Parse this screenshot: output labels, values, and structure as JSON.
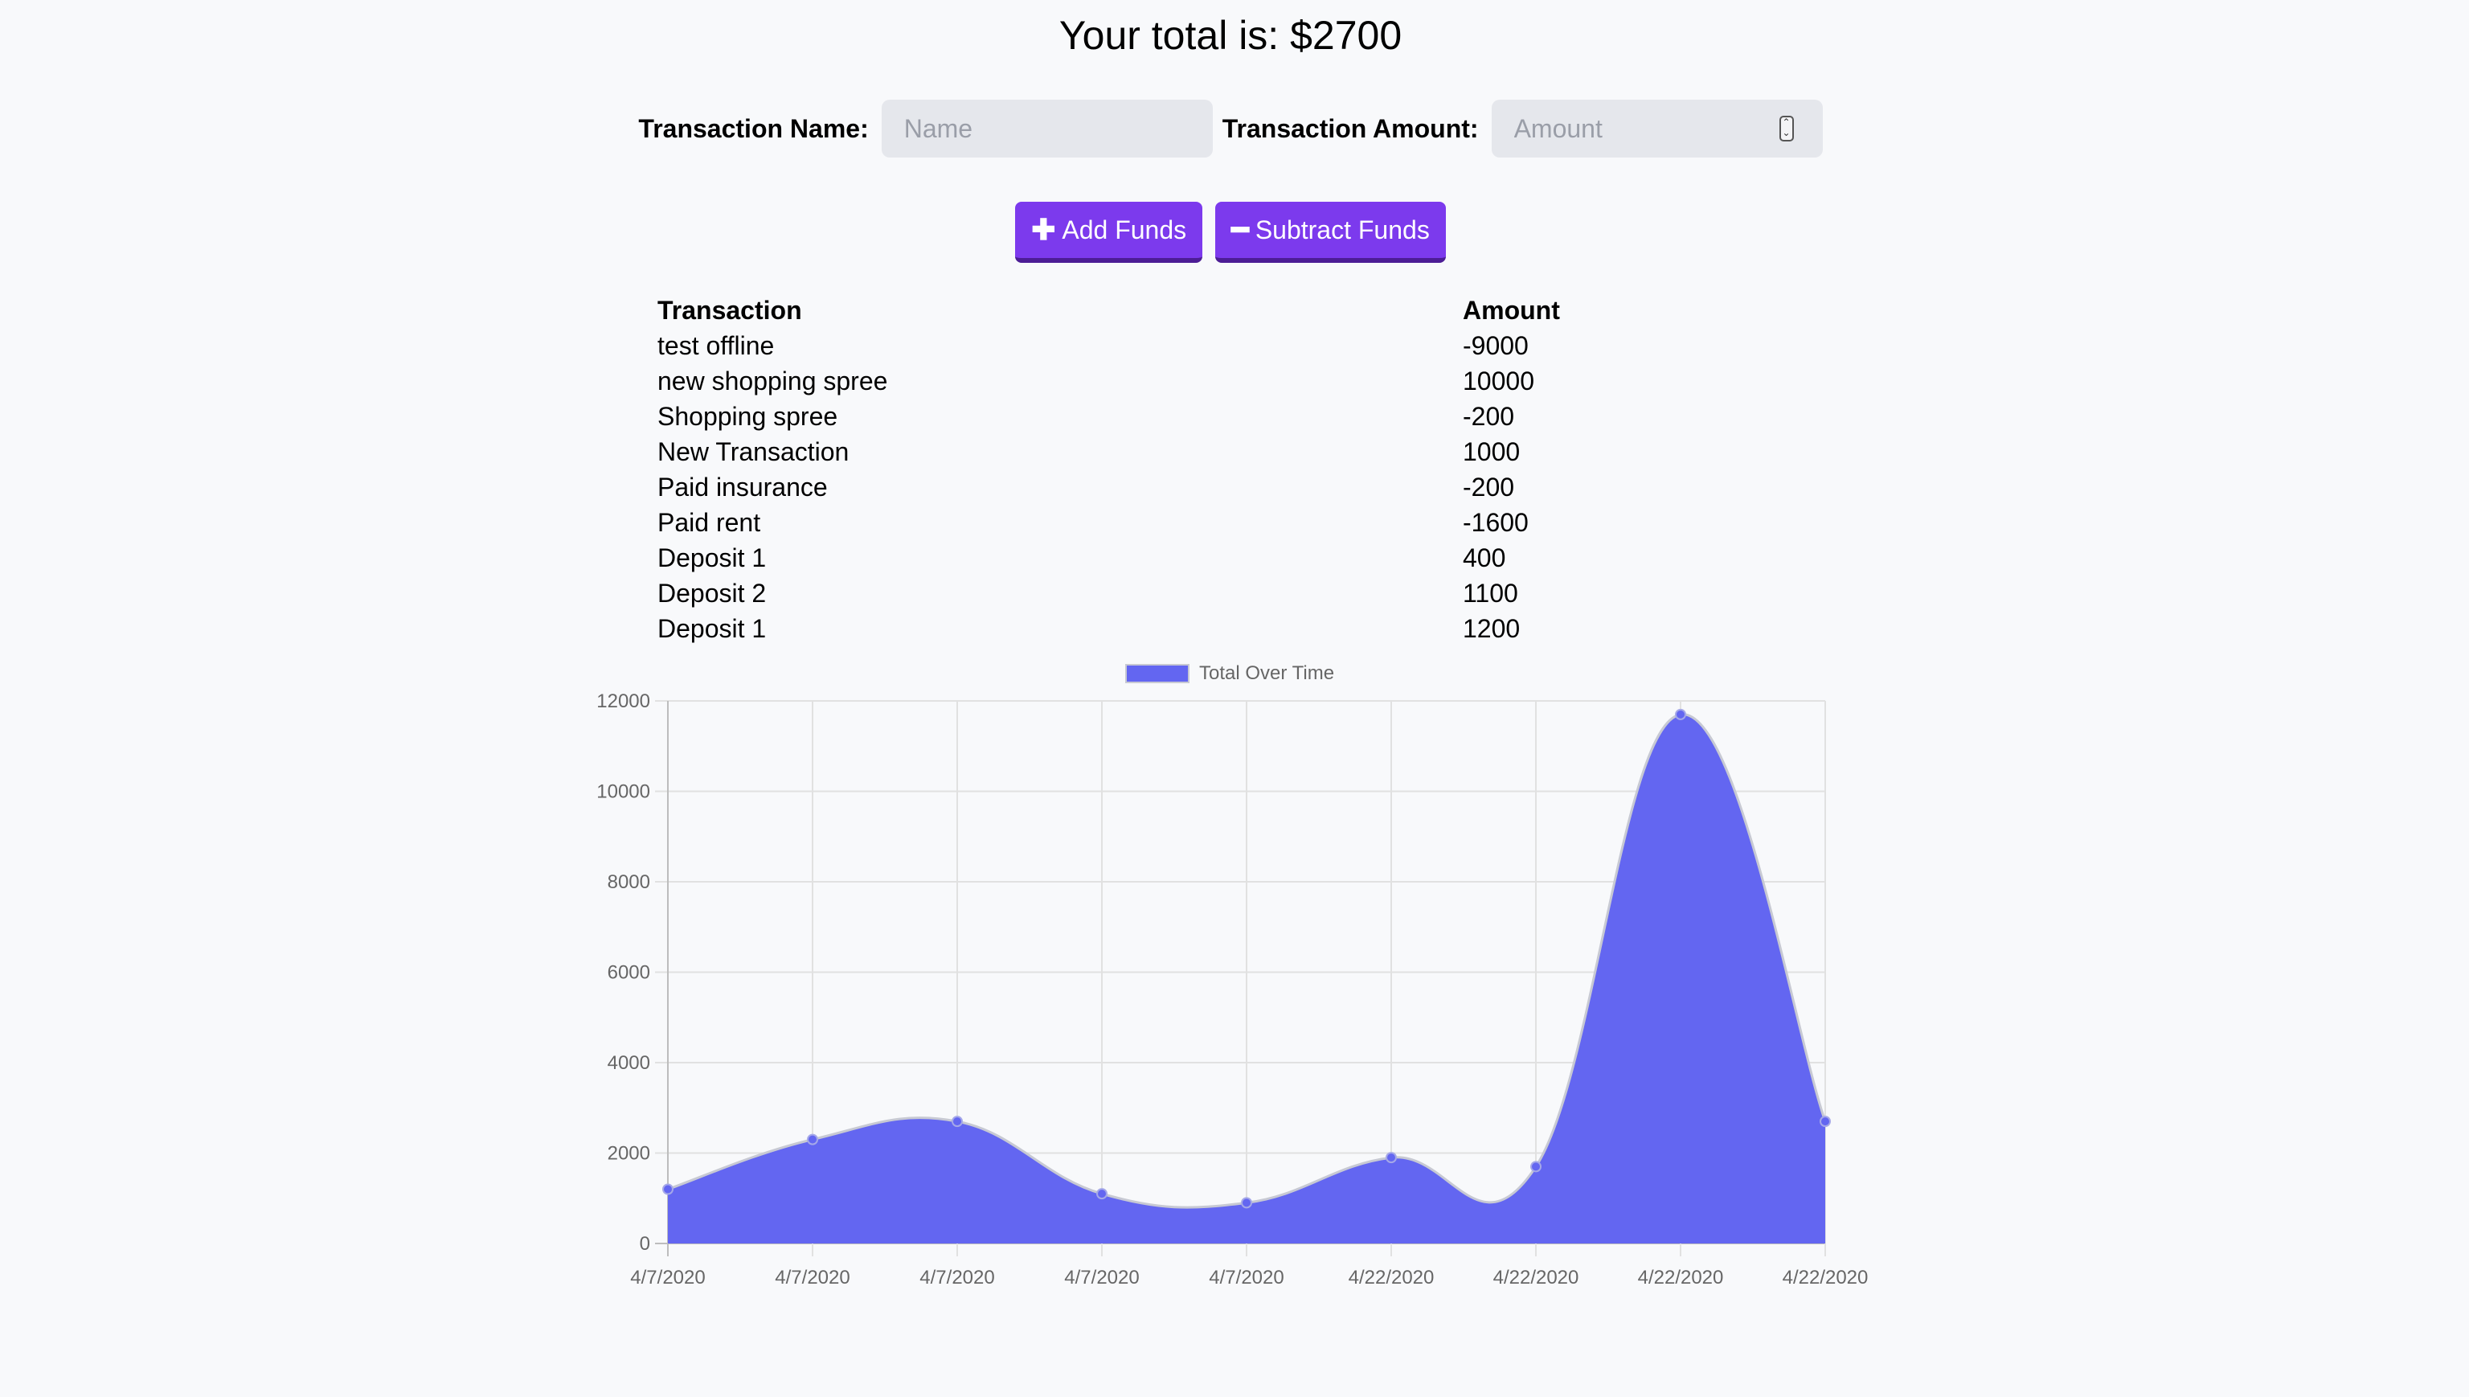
{
  "total_text": "Your total is: $2700",
  "form": {
    "name_label": "Transaction Name:",
    "name_placeholder": "Name",
    "amount_label": "Transaction Amount:",
    "amount_placeholder": "Amount"
  },
  "buttons": {
    "add_label": "Add Funds",
    "add_icon": "plus-icon",
    "subtract_label": "Subtract Funds",
    "subtract_icon": "minus-icon",
    "color": "#7c3aed"
  },
  "table": {
    "headers": [
      "Transaction",
      "Amount"
    ],
    "rows": [
      [
        "test offline",
        "-9000"
      ],
      [
        "new shopping spree",
        "10000"
      ],
      [
        "Shopping spree",
        "-200"
      ],
      [
        "New Transaction",
        "1000"
      ],
      [
        "Paid insurance",
        "-200"
      ],
      [
        "Paid rent",
        "-1600"
      ],
      [
        "Deposit 1",
        "400"
      ],
      [
        "Deposit 2",
        "1100"
      ],
      [
        "Deposit 1",
        "1200"
      ]
    ]
  },
  "chart_data": {
    "type": "area",
    "x": [
      "4/7/2020",
      "4/7/2020",
      "4/7/2020",
      "4/7/2020",
      "4/7/2020",
      "4/22/2020",
      "4/22/2020",
      "4/22/2020",
      "4/22/2020"
    ],
    "series": [
      {
        "name": "Total Over Time",
        "values": [
          1200,
          2300,
          2700,
          1100,
          900,
          1900,
          1700,
          11700,
          2700
        ],
        "color": "#6366f1"
      }
    ],
    "ylim": [
      0,
      12000
    ],
    "yticks": [
      0,
      2000,
      4000,
      6000,
      8000,
      10000,
      12000
    ],
    "grid": true,
    "legend": "top-center",
    "title": "",
    "xlabel": "",
    "ylabel": ""
  }
}
